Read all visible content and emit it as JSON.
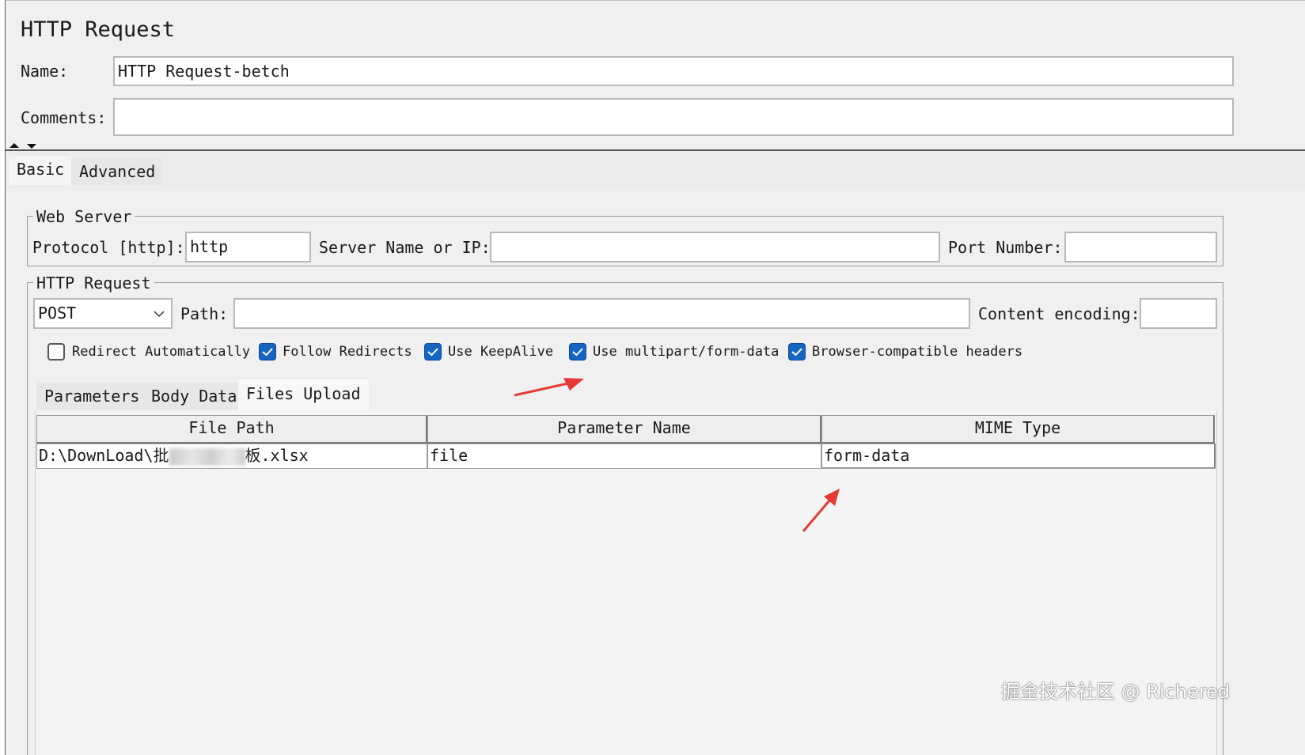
{
  "header": {
    "title": "HTTP Request",
    "name_label": "Name:",
    "name_value": "HTTP Request-betch",
    "comments_label": "Comments:",
    "comments_value": ""
  },
  "tabs": {
    "basic": "Basic",
    "advanced": "Advanced"
  },
  "web_server": {
    "title": "Web Server",
    "protocol_label": "Protocol [http]:",
    "protocol_value": "http",
    "server_label": "Server Name or IP:",
    "server_value": "",
    "port_label": "Port Number:",
    "port_value": ""
  },
  "http_request": {
    "title": "HTTP Request",
    "method": "POST",
    "path_label": "Path:",
    "path_value": "",
    "encoding_label": "Content encoding:",
    "encoding_value": "",
    "checkboxes": [
      {
        "label": "Redirect Automatically",
        "checked": false
      },
      {
        "label": "Follow Redirects",
        "checked": true
      },
      {
        "label": "Use KeepAlive",
        "checked": true
      },
      {
        "label": "Use multipart/form-data",
        "checked": true
      },
      {
        "label": "Browser-compatible headers",
        "checked": true
      }
    ]
  },
  "sub_tabs": {
    "parameters": "Parameters",
    "body_data": "Body Data",
    "files_upload": "Files Upload"
  },
  "files_table": {
    "columns": [
      "File Path",
      "Parameter Name",
      "MIME Type"
    ],
    "rows": [
      {
        "file_path_prefix": "D:\\DownLoad\\批",
        "file_path_suffix": "板.xlsx",
        "parameter_name": "file",
        "mime_type": "form-data"
      }
    ]
  },
  "watermark": "掘金技术社区 @ Richered",
  "colors": {
    "checkbox_checked": "#1565c0",
    "annotation_arrow": "#e53935",
    "panel_bg": "#f0f0f0"
  }
}
